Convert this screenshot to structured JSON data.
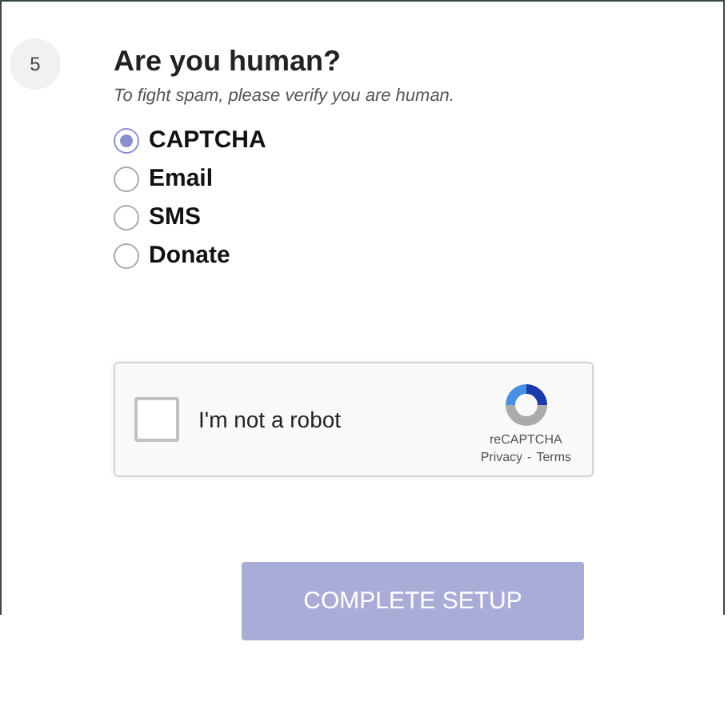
{
  "step": {
    "number": "5",
    "title": "Are you human?",
    "subtitle": "To fight spam, please verify you are human."
  },
  "options": [
    {
      "label": "CAPTCHA",
      "selected": true
    },
    {
      "label": "Email",
      "selected": false
    },
    {
      "label": "SMS",
      "selected": false
    },
    {
      "label": "Donate",
      "selected": false
    }
  ],
  "recaptcha": {
    "label": "I'm not a robot",
    "checked": false,
    "brand": "reCAPTCHA",
    "links": [
      "Privacy",
      "Terms"
    ],
    "separator": "-"
  },
  "submit": {
    "label": "COMPLETE SETUP",
    "disabled": true
  }
}
